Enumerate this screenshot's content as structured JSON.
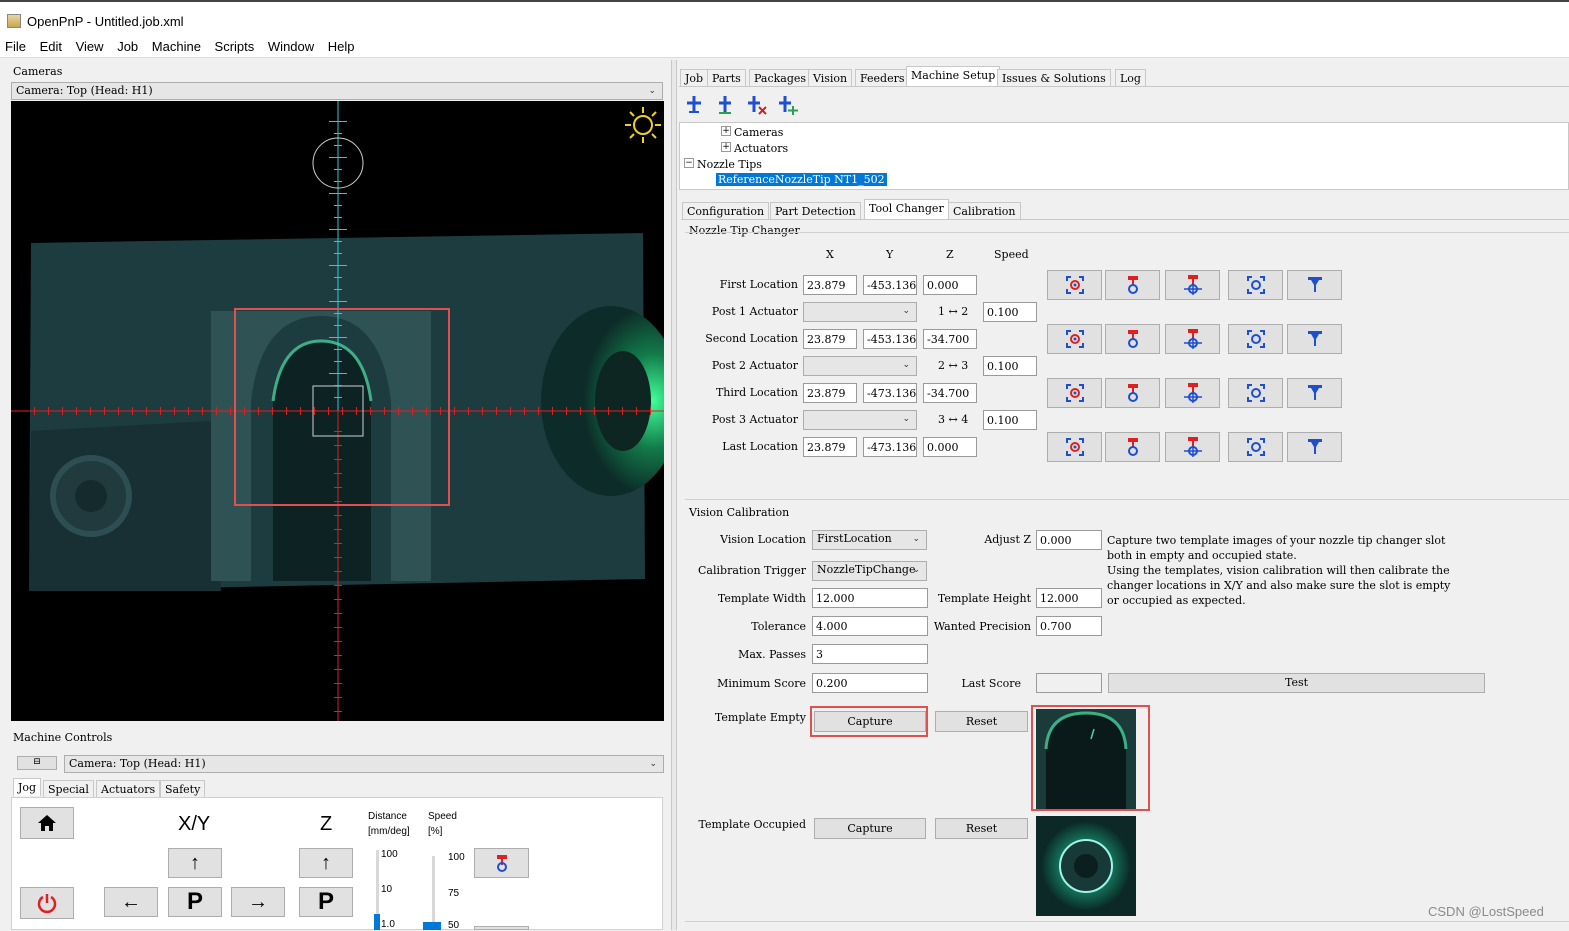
{
  "window": {
    "title": "OpenPnP - Untitled.job.xml"
  },
  "menu": [
    "File",
    "Edit",
    "View",
    "Job",
    "Machine",
    "Scripts",
    "Window",
    "Help"
  ],
  "cameras_panel": {
    "label": "Cameras",
    "camera_select": "Camera: Top (Head: H1)"
  },
  "machine_controls": {
    "label": "Machine Controls",
    "camera_select": "Camera: Top (Head: H1)",
    "tabs": [
      "Jog",
      "Special",
      "Actuators",
      "Safety"
    ],
    "xy_label": "X/Y",
    "z_label": "Z",
    "distance_label": "Distance",
    "distance_unit": "[mm/deg]",
    "speed_label": "Speed",
    "speed_unit": "[%]",
    "distance_ticks": [
      "100",
      "10",
      "1.0"
    ],
    "speed_ticks": [
      "100",
      "75",
      "50"
    ],
    "park_label": "P"
  },
  "main_tabs": [
    "Job",
    "Parts",
    "Packages",
    "Vision",
    "Feeders",
    "Machine Setup",
    "Issues & Solutions",
    "Log"
  ],
  "tree": {
    "items": [
      "Cameras",
      "Actuators",
      "Nozzle Tips"
    ],
    "selected": "ReferenceNozzleTip NT1_502"
  },
  "sub_tabs": [
    "Configuration",
    "Part Detection",
    "Tool Changer",
    "Calibration"
  ],
  "changer": {
    "section": "Nozzle Tip Changer",
    "col_x": "X",
    "col_y": "Y",
    "col_z": "Z",
    "col_speed": "Speed",
    "rows": {
      "first": {
        "label": "First Location",
        "x": "23.879",
        "y": "-453.136",
        "z": "0.000"
      },
      "post1": {
        "label": "Post 1 Actuator",
        "range": "1 ↔ 2",
        "speed": "0.100"
      },
      "second": {
        "label": "Second Location",
        "x": "23.879",
        "y": "-453.136",
        "z": "-34.700"
      },
      "post2": {
        "label": "Post 2 Actuator",
        "range": "2 ↔ 3",
        "speed": "0.100"
      },
      "third": {
        "label": "Third Location",
        "x": "23.879",
        "y": "-473.136",
        "z": "-34.700"
      },
      "post3": {
        "label": "Post 3 Actuator",
        "range": "3 ↔ 4",
        "speed": "0.100"
      },
      "last": {
        "label": "Last Location",
        "x": "23.879",
        "y": "-473.136",
        "z": "0.000"
      }
    }
  },
  "vision": {
    "section": "Vision Calibration",
    "vision_location_label": "Vision Location",
    "vision_location": "FirstLocation",
    "trigger_label": "Calibration Trigger",
    "trigger": "NozzleTipChange",
    "adjust_z_label": "Adjust Z",
    "adjust_z": "0.000",
    "template_width_label": "Template Width",
    "template_width": "12.000",
    "template_height_label": "Template Height",
    "template_height": "12.000",
    "tolerance_label": "Tolerance",
    "tolerance": "4.000",
    "wanted_precision_label": "Wanted Precision",
    "wanted_precision": "0.700",
    "max_passes_label": "Max. Passes",
    "max_passes": "3",
    "min_score_label": "Minimum Score",
    "min_score": "0.200",
    "last_score_label": "Last Score",
    "last_score": "",
    "test_label": "Test",
    "template_empty_label": "Template Empty",
    "template_occupied_label": "Template Occupied",
    "capture_label": "Capture",
    "reset_label": "Reset",
    "help": [
      "Capture two template images of your nozzle tip changer slot",
      "both in empty and occupied state.",
      "Using the templates, vision calibration will then calibrate the",
      "changer locations in X/Y and also make sure the slot is empty",
      "or occupied as expected."
    ]
  },
  "watermark": "CSDN @LostSpeed",
  "colors": {
    "selection": "#0078d7",
    "reticle": "#e02020",
    "crosshair": "#30c8d8",
    "highlight": "#e05050"
  }
}
